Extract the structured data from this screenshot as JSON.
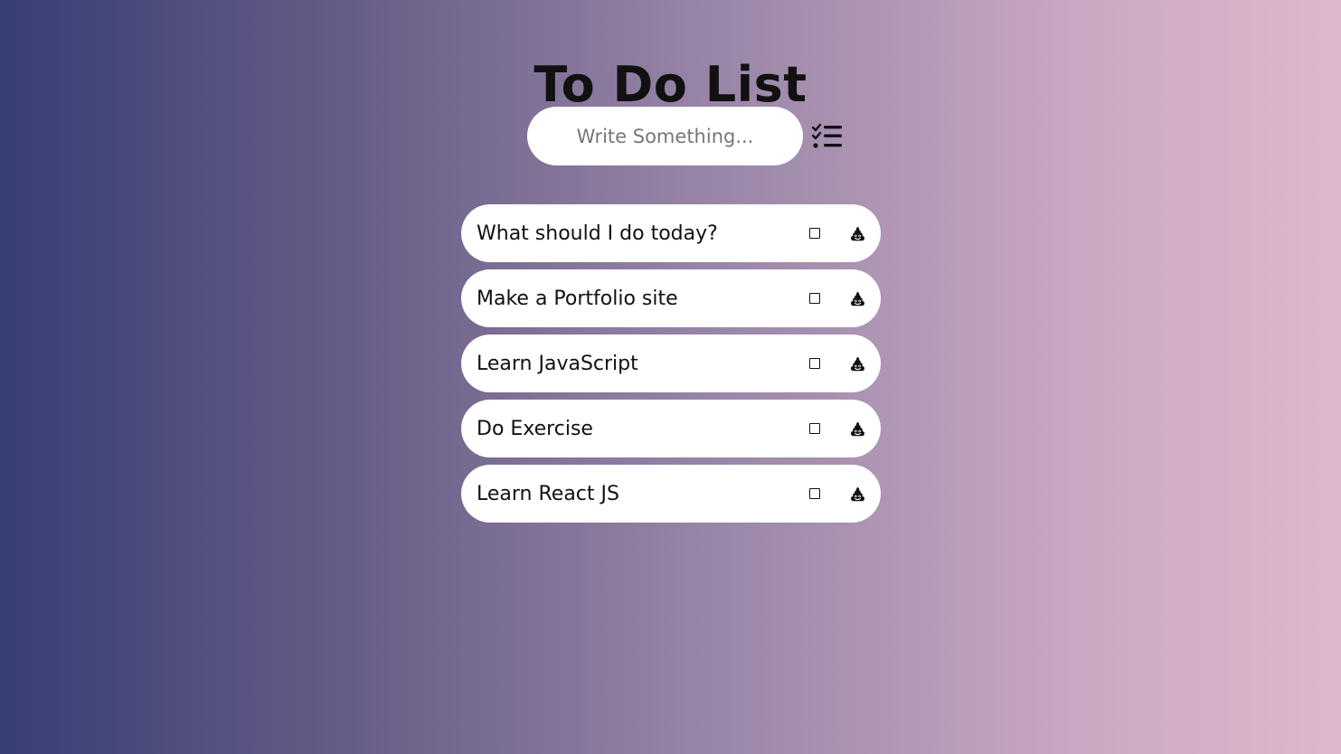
{
  "header": {
    "title": "To Do List"
  },
  "new_todo": {
    "value": "",
    "placeholder": "Write Something...",
    "add_button_icon": "tasks-list-icon"
  },
  "todos": [
    {
      "text": "What should I do today?",
      "completed": false,
      "complete_icon": "square-checkbox-icon",
      "delete_icon": "poop-icon"
    },
    {
      "text": "Make a Portfolio site",
      "completed": false,
      "complete_icon": "square-checkbox-icon",
      "delete_icon": "poop-icon"
    },
    {
      "text": "Learn JavaScript",
      "completed": false,
      "complete_icon": "square-checkbox-icon",
      "delete_icon": "poop-icon"
    },
    {
      "text": "Do Exercise",
      "completed": false,
      "complete_icon": "square-checkbox-icon",
      "delete_icon": "poop-icon"
    },
    {
      "text": "Learn React JS",
      "completed": false,
      "complete_icon": "square-checkbox-icon",
      "delete_icon": "poop-icon"
    }
  ],
  "colors": {
    "gradient_start": "#373e74",
    "gradient_end": "#dfb8cd",
    "card": "#ffffff",
    "text": "#111111"
  }
}
